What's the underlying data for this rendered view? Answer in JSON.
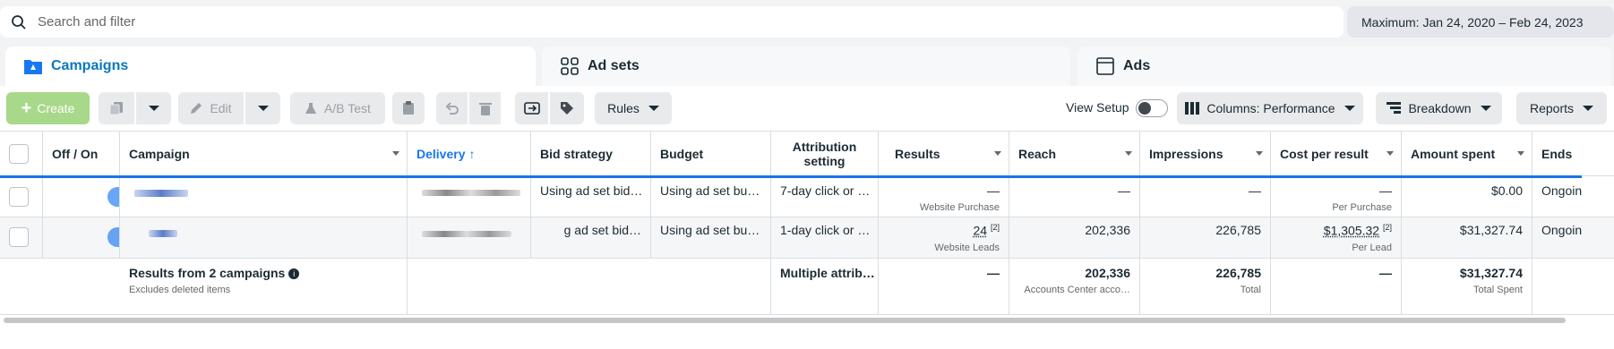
{
  "search": {
    "placeholder": "Search and filter"
  },
  "date_range": "Maximum: Jan 24, 2020 – Feb 24, 2023",
  "tabs": [
    {
      "label": "Campaigns",
      "icon": "folder-icon",
      "active": true
    },
    {
      "label": "Ad sets",
      "icon": "grid-icon",
      "active": false
    },
    {
      "label": "Ads",
      "icon": "ad-icon",
      "active": false
    }
  ],
  "toolbar": {
    "create": "Create",
    "edit": "Edit",
    "ab_test": "A/B Test",
    "rules": "Rules",
    "view_setup": "View Setup",
    "columns": "Columns: Performance",
    "breakdown": "Breakdown",
    "reports": "Reports"
  },
  "table": {
    "headers": {
      "off_on": "Off / On",
      "campaign": "Campaign",
      "delivery": "Delivery",
      "bid_strategy": "Bid strategy",
      "budget": "Budget",
      "attribution": "Attribution setting",
      "results": "Results",
      "reach": "Reach",
      "impressions": "Impressions",
      "cost_per_result": "Cost per result",
      "amount_spent": "Amount spent",
      "ends": "Ends"
    },
    "rows": [
      {
        "bid_strategy": "Using ad set bid…",
        "budget": "Using ad set bu…",
        "attribution": "7-day click or …",
        "results": "—",
        "results_sub": "Website Purchase",
        "reach": "—",
        "impressions": "—",
        "cost_per_result": "—",
        "cost_sub": "Per Purchase",
        "amount_spent": "$0.00",
        "ends": "Ongoin"
      },
      {
        "bid_strategy": "g ad set bid…",
        "budget": "Using ad set bu…",
        "attribution": "1-day click or …",
        "results": "24",
        "results_note": "[2]",
        "results_sub": "Website Leads",
        "reach": "202,336",
        "impressions": "226,785",
        "cost_per_result": "$1,305.32",
        "cost_note": "[2]",
        "cost_sub": "Per Lead",
        "amount_spent": "$31,327.74",
        "ends": "Ongoin"
      }
    ],
    "summary": {
      "title": "Results from 2 campaigns",
      "subtitle": "Excludes deleted items",
      "attribution": "Multiple attrib…",
      "results": "—",
      "reach": "202,336",
      "reach_sub": "Accounts Center acco…",
      "impressions": "226,785",
      "impressions_sub": "Total",
      "cost_per_result": "—",
      "amount_spent": "$31,327.74",
      "amount_sub": "Total Spent"
    }
  }
}
